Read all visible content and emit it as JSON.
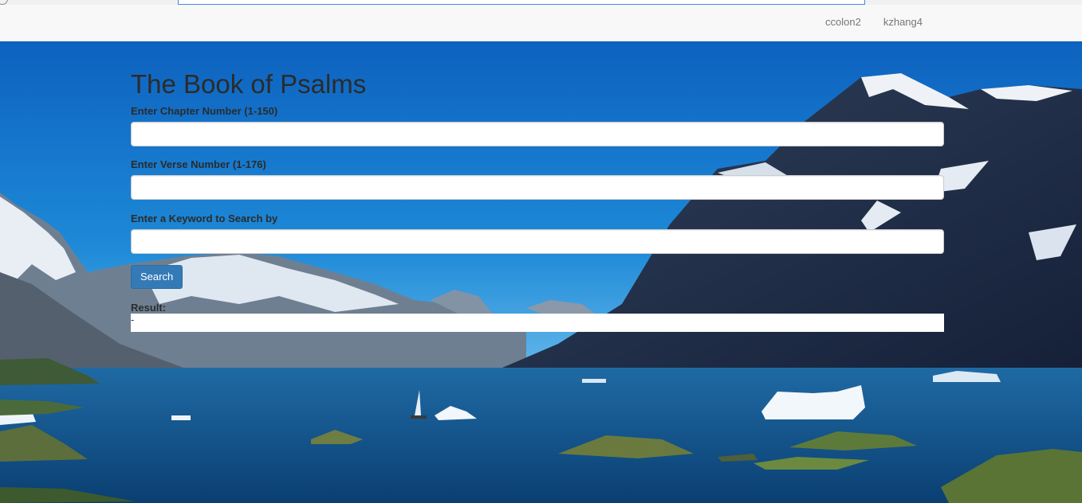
{
  "nav": {
    "links": [
      "ccolon2",
      "kzhang4"
    ]
  },
  "main": {
    "title": "The Book of Psalms",
    "chapter_label": "Enter Chapter Number (1-150)",
    "chapter_value": "",
    "verse_label": "Enter Verse Number (1-176)",
    "verse_value": "",
    "keyword_label": "Enter a Keyword to Search by",
    "keyword_value": "",
    "search_button": "Search",
    "result_label": "Result:",
    "result_value": "-"
  },
  "colors": {
    "button": "#337ab7",
    "navbar": "#f8f8f8",
    "sky": "#1b74c8",
    "water": "#0f4f86"
  }
}
